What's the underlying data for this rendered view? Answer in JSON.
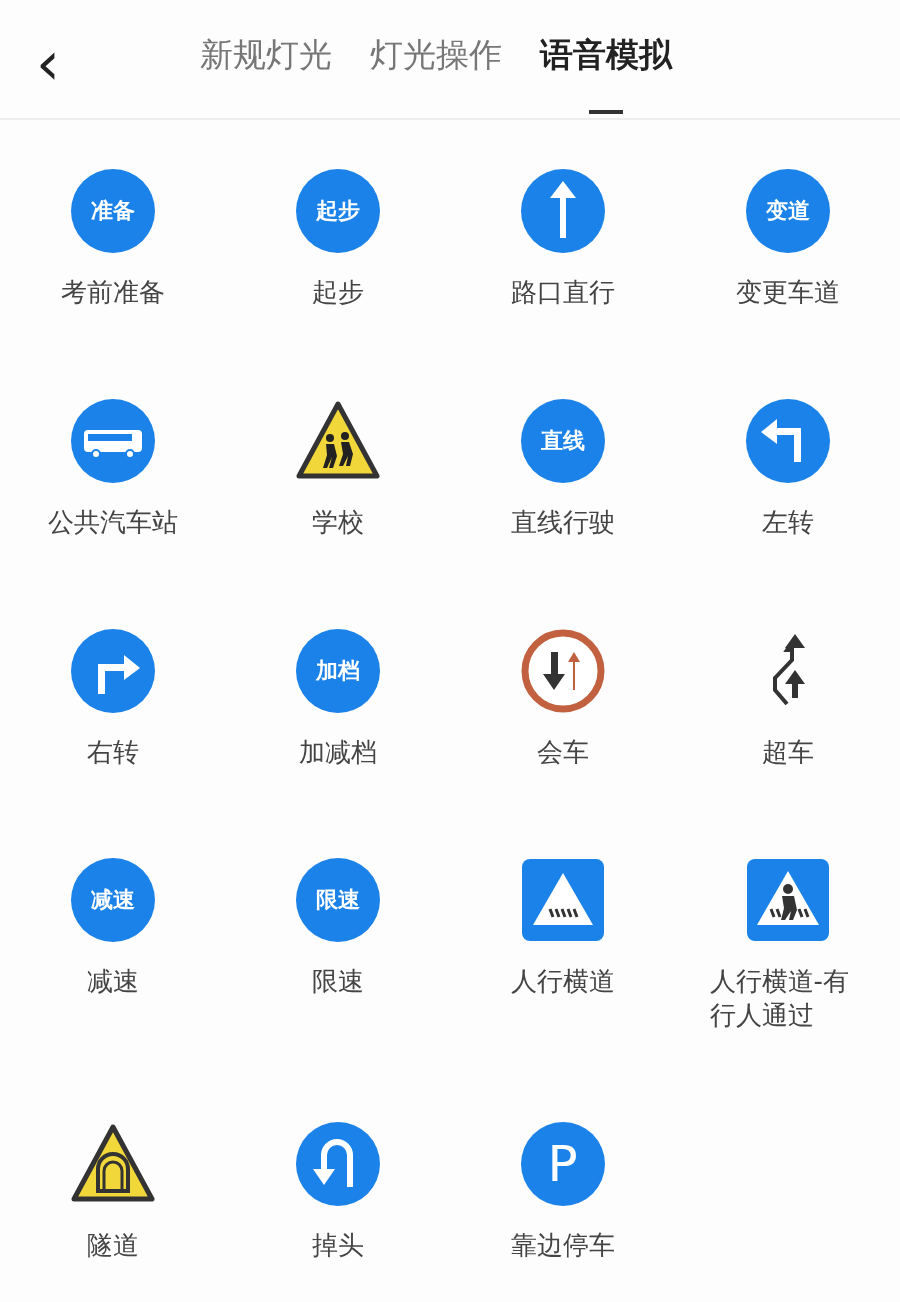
{
  "header": {
    "back": "‹",
    "tabs": [
      {
        "label": "新规灯光",
        "selected": false
      },
      {
        "label": "灯光操作",
        "selected": false
      },
      {
        "label": "语音模拟",
        "selected": true
      }
    ]
  },
  "items": [
    {
      "label": "考前准备",
      "sign": {
        "kind": "badge",
        "text": "准备"
      }
    },
    {
      "label": "起步",
      "sign": {
        "kind": "badge",
        "text": "起步"
      }
    },
    {
      "label": "路口直行",
      "sign": {
        "kind": "straight"
      }
    },
    {
      "label": "变更车道",
      "sign": {
        "kind": "badge",
        "text": "变道"
      }
    },
    {
      "label": "公共汽车站",
      "sign": {
        "kind": "bus"
      }
    },
    {
      "label": "学校",
      "sign": {
        "kind": "school"
      }
    },
    {
      "label": "直线行驶",
      "sign": {
        "kind": "badge",
        "text": "直线"
      }
    },
    {
      "label": "左转",
      "sign": {
        "kind": "left"
      }
    },
    {
      "label": "右转",
      "sign": {
        "kind": "right"
      }
    },
    {
      "label": "加减档",
      "sign": {
        "kind": "badge",
        "text": "加档"
      }
    },
    {
      "label": "会车",
      "sign": {
        "kind": "meet"
      }
    },
    {
      "label": "超车",
      "sign": {
        "kind": "overtake"
      }
    },
    {
      "label": "减速",
      "sign": {
        "kind": "badge",
        "text": "减速"
      }
    },
    {
      "label": "限速",
      "sign": {
        "kind": "badge",
        "text": "限速"
      }
    },
    {
      "label": "人行横道",
      "sign": {
        "kind": "crosswalk"
      }
    },
    {
      "label": "人行横道-有行人通过",
      "sign": {
        "kind": "pedestrian"
      }
    },
    {
      "label": "隧道",
      "sign": {
        "kind": "tunnel"
      }
    },
    {
      "label": "掉头",
      "sign": {
        "kind": "uturn"
      }
    },
    {
      "label": "靠边停车",
      "sign": {
        "kind": "badge",
        "text": "P"
      }
    }
  ]
}
